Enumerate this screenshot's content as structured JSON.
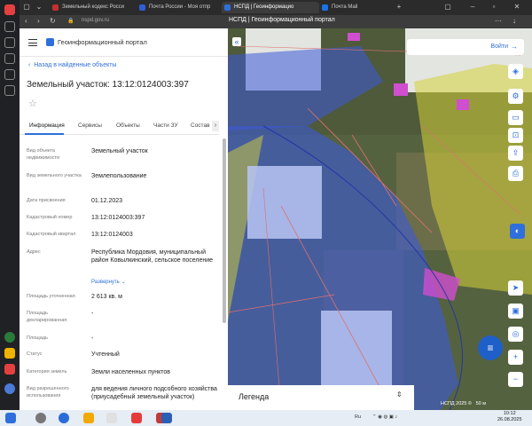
{
  "browser": {
    "tabs": [
      {
        "label": "Земельный кодекс Росси"
      },
      {
        "label": "Почта России - Моя отпр"
      },
      {
        "label": "НСПД | Геоинформацио"
      },
      {
        "label": "Почта Mail"
      }
    ],
    "url": "nspd.gov.ru",
    "page_title": "НСПД | Геоинформационный портал"
  },
  "app": {
    "portal_title": "Геоинформационный портал",
    "back_link": "Назад в найденные объекты",
    "object_title": "Земельный участок: 13:12:0124003:397",
    "tabs": [
      "Информация",
      "Сервисы",
      "Объекты",
      "Части ЗУ",
      "Состав"
    ],
    "fields": [
      {
        "label": "Вид объекта недвижимости",
        "value": "Земельный участок"
      },
      {
        "label": "Вид земельного участка",
        "value": "Землепользование"
      },
      {
        "label": "Дата присвоения",
        "value": "01.12.2023"
      },
      {
        "label": "Кадастровый номер",
        "value": "13:12:0124003:397"
      },
      {
        "label": "Кадастровый квартал",
        "value": "13:12:0124003"
      },
      {
        "label": "Адрес",
        "value": "Республика Мордовия, муниципальный район Ковылкинский, сельское поселение"
      },
      {
        "label": "Площадь уточненная",
        "value": "2 613 кв. м"
      },
      {
        "label": "Площадь декларированная",
        "value": "-"
      },
      {
        "label": "Площадь",
        "value": "-"
      },
      {
        "label": "Статус",
        "value": "Учтенный"
      },
      {
        "label": "Категория земель",
        "value": "Земли населенных пунктов"
      },
      {
        "label": "Вид разрешенного использования",
        "value": "для ведения личного подсобного хозяйства (приусадебный земельный участок)"
      }
    ],
    "expand_link": "Развернуть"
  },
  "map": {
    "login_label": "Войти",
    "legend_label": "Легенда",
    "scale_label": "НСПД 2025 ©",
    "scale_value": "50 м"
  },
  "taskbar": {
    "lang": "Ru",
    "time": "10:12",
    "date": "26.08.2025"
  },
  "colors": {
    "accent": "#2f6fdc",
    "zone_blue": "#3c5ad8",
    "zone_yellow": "#d6d23a",
    "parcel_magenta": "#d04ed0"
  }
}
